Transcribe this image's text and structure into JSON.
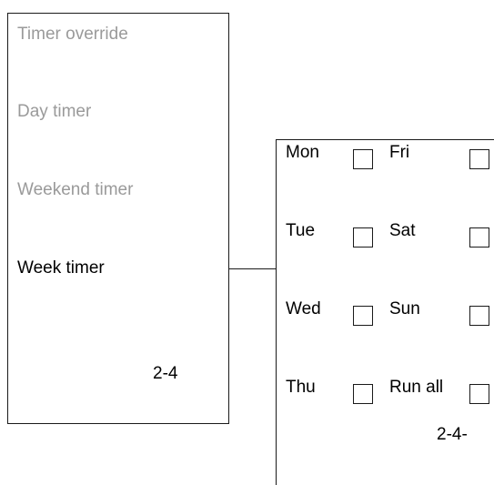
{
  "menu": {
    "items": [
      {
        "label": "Timer override",
        "state": "dimmed"
      },
      {
        "label": "Day timer",
        "state": "dimmed"
      },
      {
        "label": "Weekend timer",
        "state": "dimmed"
      },
      {
        "label": "Week timer",
        "state": "active"
      }
    ],
    "page_code": "2-4"
  },
  "day_selector": {
    "days": [
      {
        "label": "Mon",
        "checked": false
      },
      {
        "label": "Tue",
        "checked": false
      },
      {
        "label": "Wed",
        "checked": false
      },
      {
        "label": "Thu",
        "checked": false
      },
      {
        "label": "Fri",
        "checked": false
      },
      {
        "label": "Sat",
        "checked": false
      },
      {
        "label": "Sun",
        "checked": false
      },
      {
        "label": "Run all",
        "checked": false
      }
    ],
    "page_code": "2-4-"
  },
  "colors": {
    "line": "#1a1a1a",
    "text": "#000000",
    "dimmed_text": "#9a9a9a",
    "background": "#ffffff"
  }
}
